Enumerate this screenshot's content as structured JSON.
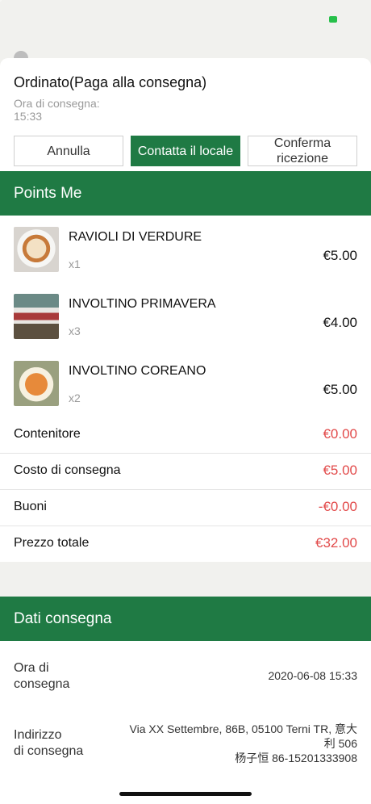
{
  "colors": {
    "brand_green": "#1f7a44",
    "price_red": "#e24a4a",
    "muted": "#9a9a9a"
  },
  "order": {
    "status_title": "Ordinato(Paga alla consegna)",
    "eta_label": "Ora di consegna:",
    "eta_value": "15:33"
  },
  "actions": {
    "cancel": "Annulla",
    "contact": "Contatta il locale",
    "confirm_line1": "Conferma",
    "confirm_line2": "ricezione"
  },
  "store": {
    "name": "Points Me"
  },
  "items": [
    {
      "name": "RAVIOLI DI VERDURE",
      "qty": "x1",
      "price": "€5.00",
      "image_icon": "ravioli-dish-photo"
    },
    {
      "name": "INVOLTINO PRIMAVERA",
      "qty": "x3",
      "price": "€4.00",
      "image_icon": "spring-roll-dish-photo"
    },
    {
      "name": "INVOLTINO COREANO",
      "qty": "x2",
      "price": "€5.00",
      "image_icon": "korean-roll-dish-photo"
    }
  ],
  "fees": [
    {
      "label": "Contenitore",
      "value": "€0.00"
    },
    {
      "label": "Costo di consegna",
      "value": "€5.00"
    },
    {
      "label": "Buoni",
      "value": "-€0.00"
    },
    {
      "label": "Prezzo totale",
      "value": "€32.00"
    }
  ],
  "delivery": {
    "header": "Dati consegna",
    "time_label_1": "Ora di",
    "time_label_2": "consegna",
    "time_value": "2020-06-08 15:33",
    "address_label_1": "Indirizzo",
    "address_label_2": "di consegna",
    "address_line1": "Via XX Settembre, 86B, 05100 Terni TR, 意大",
    "address_line2": "利 506",
    "address_line3": "杨子恒 86-15201333908"
  }
}
